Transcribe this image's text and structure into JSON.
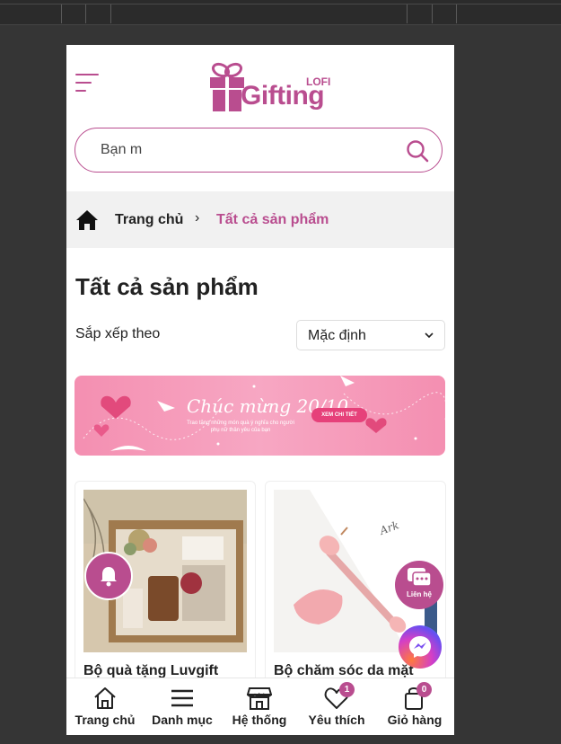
{
  "brand": {
    "name": "Gifting",
    "sub": "LOFI",
    "color": "#b94d8f"
  },
  "search": {
    "value": "Bạn m",
    "icon": "search-icon"
  },
  "breadcrumb": {
    "home": "Trang chủ",
    "separator": "›",
    "current": "Tất cả sản phẩm"
  },
  "page_title": "Tất cả sản phẩm",
  "sort": {
    "label": "Sắp xếp theo",
    "selected": "Mặc định"
  },
  "banner": {
    "title": "Chúc mừng 20/10",
    "subtitle": "Trao tặng những món quà ý nghĩa cho người phụ nữ thân yêu của bạn",
    "button": "XEM CHI TIẾT"
  },
  "products": [
    {
      "name": "Bộ quà tặng Luvgift"
    },
    {
      "name": "Bộ chăm sóc da mặt"
    }
  ],
  "floating": {
    "contact": "Liên hệ"
  },
  "bottom_nav": [
    {
      "label": "Trang chủ",
      "icon": "home-icon"
    },
    {
      "label": "Danh mục",
      "icon": "menu-icon"
    },
    {
      "label": "Hệ thống",
      "icon": "store-icon"
    },
    {
      "label": "Yêu thích",
      "icon": "heart-icon",
      "badge": "1"
    },
    {
      "label": "Giỏ hàng",
      "icon": "bag-icon",
      "badge": "0"
    }
  ]
}
